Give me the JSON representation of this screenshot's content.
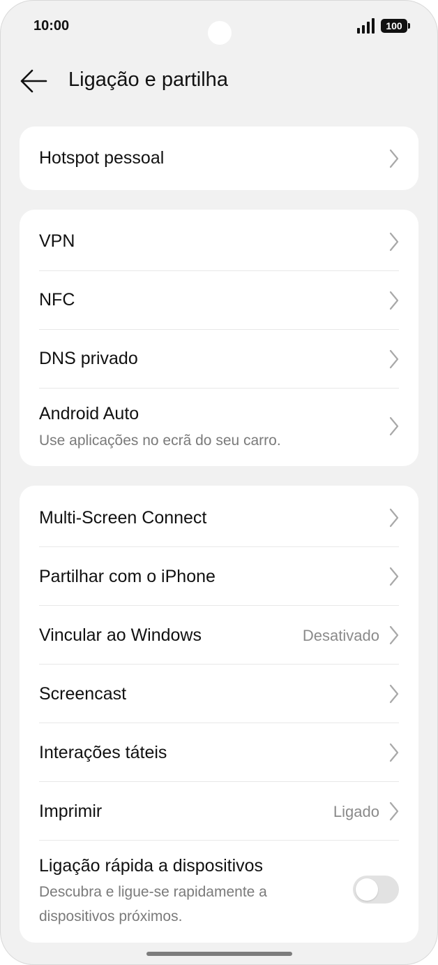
{
  "status_bar": {
    "time": "10:00",
    "battery": "100"
  },
  "header": {
    "title": "Ligação e partilha"
  },
  "section1": {
    "hotspot_label": "Hotspot pessoal"
  },
  "section2": {
    "vpn_label": "VPN",
    "nfc_label": "NFC",
    "dns_label": "DNS privado",
    "android_auto_label": "Android Auto",
    "android_auto_sub": "Use aplicações no ecrã do seu carro."
  },
  "section3": {
    "multiscreen_label": "Multi-Screen Connect",
    "iphone_label": "Partilhar com o iPhone",
    "windows_label": "Vincular ao Windows",
    "windows_value": "Desativado",
    "screencast_label": "Screencast",
    "haptics_label": "Interações táteis",
    "print_label": "Imprimir",
    "print_value": "Ligado",
    "quick_link_label": "Ligação rápida a dispositivos",
    "quick_link_sub": "Descubra e ligue-se rapidamente a dispositivos próximos.",
    "quick_link_enabled": false
  }
}
